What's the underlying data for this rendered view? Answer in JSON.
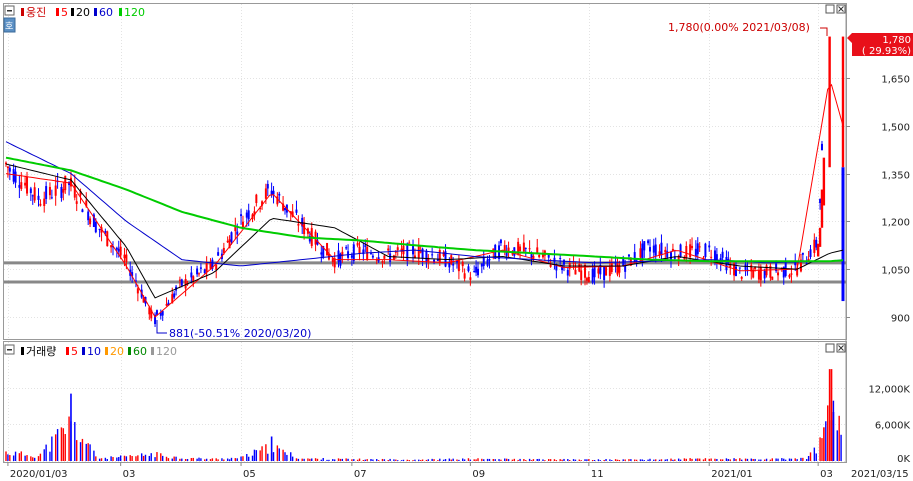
{
  "price_panel": {
    "legend": [
      {
        "label": "웅진",
        "color": "#cc0000"
      },
      {
        "label": "5",
        "color": "#ff0000"
      },
      {
        "label": "20",
        "color": "#000000"
      },
      {
        "label": "60",
        "color": "#0000cc"
      },
      {
        "label": "120",
        "color": "#00cc00"
      }
    ],
    "side_button": "호",
    "high_note": "1,780(0.00% 2021/03/08)",
    "low_note": "881(-50.51% 2020/03/20)",
    "current_price": "1,780",
    "current_change": "( 29.93%)"
  },
  "volume_panel": {
    "legend": [
      {
        "label": "거래량",
        "color": "#000000"
      },
      {
        "label": "5",
        "color": "#ff0000"
      },
      {
        "label": "10",
        "color": "#0000cc"
      },
      {
        "label": "20",
        "color": "#ff9900"
      },
      {
        "label": "60",
        "color": "#008800"
      },
      {
        "label": "120",
        "color": "#999999"
      }
    ]
  },
  "colors": {
    "up": "#ff0000",
    "down": "#0000ff",
    "ma5": "#ff0000",
    "ma20": "#000000",
    "ma60": "#0000cc",
    "ma120": "#00cc00",
    "hline": "#888888"
  },
  "chart_data": [
    {
      "type": "candlestick",
      "title": "웅진",
      "ylim": [
        840,
        1790
      ],
      "yticks": [
        "1,650",
        "1,500",
        "1,350",
        "1,200",
        "1,050",
        "900"
      ],
      "ytick_values": [
        1650,
        1500,
        1350,
        1200,
        1050,
        900
      ],
      "horizontal_lines": [
        1070,
        1010
      ],
      "high": {
        "value": 1780,
        "date": "2021/03/08"
      },
      "low": {
        "value": 881,
        "date": "2020/03/20"
      },
      "x_start": "2020/01/02",
      "x_end": "2021/03/15",
      "series": [
        {
          "name": "price",
          "x": [
            "2020-01-02",
            "2020-01-20",
            "2020-02-05",
            "2020-02-20",
            "2020-03-05",
            "2020-03-20",
            "2020-04-03",
            "2020-04-20",
            "2020-05-04",
            "2020-05-20",
            "2020-06-05",
            "2020-06-22",
            "2020-07-06",
            "2020-07-20",
            "2020-08-03",
            "2020-08-20",
            "2020-09-03",
            "2020-09-18",
            "2020-10-05",
            "2020-10-20",
            "2020-11-05",
            "2020-11-20",
            "2020-12-04",
            "2020-12-18",
            "2021-01-05",
            "2021-01-20",
            "2021-02-03",
            "2021-02-19",
            "2021-03-02",
            "2021-03-08",
            "2021-03-15"
          ],
          "y": [
            1380,
            1270,
            1320,
            1180,
            1080,
            890,
            1000,
            1060,
            1200,
            1300,
            1190,
            1080,
            1110,
            1090,
            1110,
            1080,
            1030,
            1120,
            1100,
            1060,
            1030,
            1060,
            1120,
            1100,
            1110,
            1040,
            1040,
            1050,
            1130,
            1780,
            1370
          ]
        },
        {
          "name": "5",
          "x": [
            "2020-01-02",
            "2020-02-05",
            "2020-03-05",
            "2020-03-20",
            "2020-04-20",
            "2020-05-20",
            "2020-06-22",
            "2020-07-20",
            "2020-08-20",
            "2020-09-18",
            "2020-10-20",
            "2020-11-20",
            "2020-12-18",
            "2021-01-20",
            "2021-02-19",
            "2021-03-08",
            "2021-03-15"
          ],
          "y": [
            1350,
            1320,
            1060,
            900,
            1060,
            1290,
            1080,
            1080,
            1070,
            1110,
            1055,
            1060,
            1110,
            1045,
            1050,
            1650,
            1500
          ]
        },
        {
          "name": "20",
          "x": [
            "2020-01-02",
            "2020-02-05",
            "2020-03-05",
            "2020-03-20",
            "2020-04-20",
            "2020-05-20",
            "2020-06-22",
            "2020-07-20",
            "2020-08-20",
            "2020-09-18",
            "2020-10-20",
            "2020-11-20",
            "2020-12-18",
            "2021-01-20",
            "2021-02-19",
            "2021-03-08",
            "2021-03-15"
          ],
          "y": [
            1380,
            1330,
            1120,
            960,
            1040,
            1210,
            1180,
            1090,
            1080,
            1090,
            1060,
            1060,
            1090,
            1060,
            1050,
            1100,
            1110
          ]
        },
        {
          "name": "60",
          "x": [
            "2020-01-02",
            "2020-02-05",
            "2020-03-05",
            "2020-04-03",
            "2020-05-04",
            "2020-06-05",
            "2020-07-06",
            "2020-08-03",
            "2020-09-03",
            "2020-10-05",
            "2020-11-05",
            "2020-12-04",
            "2021-01-05",
            "2021-02-03",
            "2021-03-08",
            "2021-03-15"
          ],
          "y": [
            1450,
            1350,
            1200,
            1080,
            1060,
            1080,
            1100,
            1110,
            1090,
            1080,
            1070,
            1075,
            1080,
            1070,
            1075,
            1080
          ]
        },
        {
          "name": "120",
          "x": [
            "2020-01-02",
            "2020-02-05",
            "2020-03-05",
            "2020-04-03",
            "2020-05-04",
            "2020-06-05",
            "2020-07-06",
            "2020-08-03",
            "2020-09-03",
            "2020-10-05",
            "2020-11-05",
            "2020-12-04",
            "2021-01-05",
            "2021-02-03",
            "2021-03-08",
            "2021-03-15"
          ],
          "y": [
            1400,
            1360,
            1300,
            1230,
            1180,
            1150,
            1140,
            1125,
            1110,
            1100,
            1090,
            1080,
            1075,
            1075,
            1075,
            1078
          ]
        }
      ]
    },
    {
      "type": "bar",
      "title": "거래량",
      "ylim": [
        0,
        16000
      ],
      "yticks": [
        "12,000K",
        "6,000K",
        "0K"
      ],
      "ytick_values": [
        12000,
        6000,
        0
      ],
      "series": [
        {
          "name": "거래량",
          "x": [
            "2020-01-02",
            "2020-01-20",
            "2020-02-05",
            "2020-02-20",
            "2020-03-05",
            "2020-03-20",
            "2020-04-03",
            "2020-04-20",
            "2020-05-04",
            "2020-05-20",
            "2020-06-05",
            "2020-07-06",
            "2020-08-03",
            "2020-09-03",
            "2020-10-05",
            "2020-11-05",
            "2020-12-04",
            "2021-01-05",
            "2021-02-03",
            "2021-02-25",
            "2021-03-04",
            "2021-03-08",
            "2021-03-15"
          ],
          "y": [
            2500,
            1500,
            11000,
            800,
            1200,
            2000,
            900,
            600,
            900,
            4000,
            700,
            500,
            400,
            600,
            450,
            400,
            450,
            700,
            500,
            800,
            5500,
            15000,
            8000
          ]
        }
      ]
    }
  ],
  "x_axis": {
    "ticks": [
      {
        "label": "2020/01/03",
        "date": "2020-01-03"
      },
      {
        "label": "03",
        "date": "2020-03-02"
      },
      {
        "label": "05",
        "date": "2020-05-04"
      },
      {
        "label": "07",
        "date": "2020-07-01"
      },
      {
        "label": "09",
        "date": "2020-09-01"
      },
      {
        "label": "11",
        "date": "2020-11-02"
      },
      {
        "label": "2021/01",
        "date": "2021-01-04"
      },
      {
        "label": "03",
        "date": "2021-03-02"
      }
    ],
    "end_label": "2021/03/15"
  }
}
